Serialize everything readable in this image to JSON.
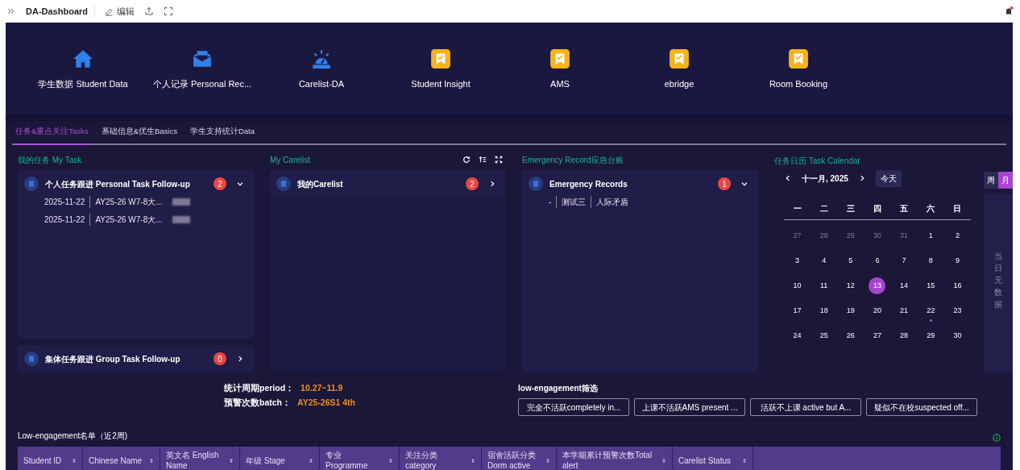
{
  "toolbar": {
    "title": "DA-Dashboard",
    "edit_label": "编辑"
  },
  "apps": [
    {
      "label": "学生数据 Student Data",
      "kind": "home"
    },
    {
      "label": "个人记录 Personal Rec...",
      "kind": "tray"
    },
    {
      "label": "Carelist-DA",
      "kind": "siren"
    },
    {
      "label": "Student Insight",
      "kind": "bookmark"
    },
    {
      "label": "AMS",
      "kind": "bookmark"
    },
    {
      "label": "ebridge",
      "kind": "bookmark"
    },
    {
      "label": "Room Booking",
      "kind": "bookmark"
    }
  ],
  "tabs": [
    {
      "label": "任务&重点关注Tasks",
      "selected": true
    },
    {
      "label": "基础信息&优生Basics",
      "selected": false
    },
    {
      "label": "学生支持统计Data",
      "selected": false
    }
  ],
  "my_task": {
    "title": "我的任务 My Task",
    "groups": [
      {
        "title": "个人任务跟进 Personal Task Follow-up",
        "count": "2",
        "expanded": true,
        "rows": [
          [
            "2025-11-22",
            "AY25-26 W7-8大..."
          ],
          [
            "2025-11-22",
            "AY25-26 W7-8大..."
          ]
        ]
      },
      {
        "title": "集体任务跟进 Group Task Follow-up",
        "count": "0",
        "expanded": false
      }
    ]
  },
  "my_carelist": {
    "title": "My Carelist",
    "groups": [
      {
        "title": "我的Carelist",
        "count": "2",
        "expanded": false
      }
    ]
  },
  "emergency": {
    "title": "Emergency Record应急台账",
    "groups": [
      {
        "title": "Emergency Records",
        "count": "1",
        "expanded": true,
        "rows": [
          [
            "-",
            "测试三",
            "人际矛盾"
          ]
        ]
      }
    ]
  },
  "calendar": {
    "title": "任务日历 Task Calendar",
    "month": "十一月, 2025",
    "today_label": "今天",
    "views": [
      {
        "label": "周",
        "selected": false
      },
      {
        "label": "月",
        "selected": true
      }
    ],
    "weekdays": [
      "一",
      "二",
      "三",
      "四",
      "五",
      "六",
      "日"
    ],
    "weeks": [
      [
        {
          "day": "27",
          "muted": true
        },
        {
          "day": "28",
          "muted": true
        },
        {
          "day": "29",
          "muted": true
        },
        {
          "day": "30",
          "muted": true
        },
        {
          "day": "31",
          "muted": true
        },
        {
          "day": "1"
        },
        {
          "day": "2"
        }
      ],
      [
        {
          "day": "3"
        },
        {
          "day": "4"
        },
        {
          "day": "5"
        },
        {
          "day": "6"
        },
        {
          "day": "7"
        },
        {
          "day": "8"
        },
        {
          "day": "9"
        }
      ],
      [
        {
          "day": "10"
        },
        {
          "day": "11"
        },
        {
          "day": "12"
        },
        {
          "day": "13",
          "selected": true
        },
        {
          "day": "14"
        },
        {
          "day": "15"
        },
        {
          "day": "16"
        }
      ],
      [
        {
          "day": "17"
        },
        {
          "day": "18"
        },
        {
          "day": "19"
        },
        {
          "day": "20"
        },
        {
          "day": "21"
        },
        {
          "day": "22",
          "event": true
        },
        {
          "day": "23"
        }
      ],
      [
        {
          "day": "24"
        },
        {
          "day": "25"
        },
        {
          "day": "26"
        },
        {
          "day": "27"
        },
        {
          "day": "28"
        },
        {
          "day": "29"
        },
        {
          "day": "30"
        }
      ]
    ],
    "empty_text": "当日无数据"
  },
  "stats": [
    {
      "label": "统计周期period：",
      "value": "10.27~11.9"
    },
    {
      "label": "预警次数batch：",
      "value": "AY25-26S1 4th"
    }
  ],
  "filter": {
    "title": "low-engagement筛选",
    "options": [
      "完全不活跃completely in...",
      "上课不活跃AMS present ...",
      "活跃不上课 active but A...",
      "疑似不在校suspected off..."
    ]
  },
  "table": {
    "title": "Low-engagement名单（近2周)",
    "columns": [
      "Student ID",
      "Chinese Name",
      "英文名 English Name",
      "年级 Stage",
      "专业 Programme",
      "关注分类category",
      "宿舍活跃分类 Dorm active",
      "本学期累计预警次数Total alert",
      "Carelist Status"
    ]
  }
}
